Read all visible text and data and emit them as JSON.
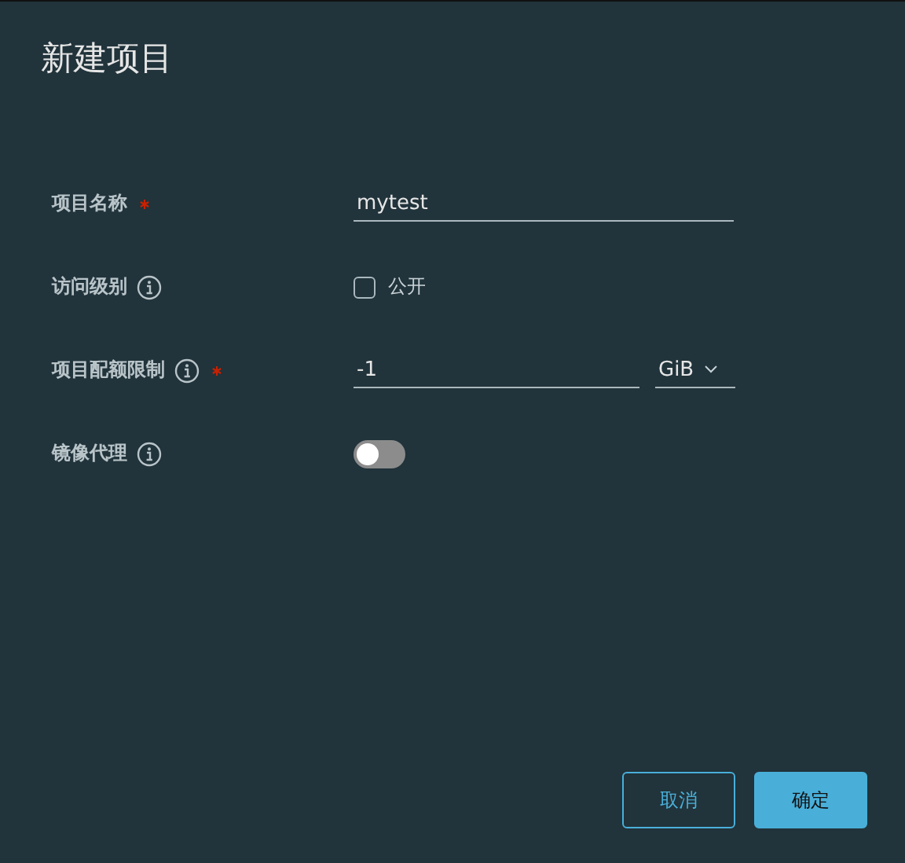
{
  "dialog": {
    "title": "新建项目"
  },
  "fields": [
    {
      "kind": "text",
      "label": "项目名称",
      "required": true,
      "info": false,
      "value": "mytest"
    },
    {
      "kind": "checkbox",
      "label": "访问级别",
      "required": false,
      "info": true,
      "option": "公开",
      "checked": false
    },
    {
      "kind": "quota",
      "label": "项目配额限制",
      "required": true,
      "info": true,
      "value": "-1",
      "unit": "GiB"
    },
    {
      "kind": "toggle",
      "label": "镜像代理",
      "required": false,
      "info": true,
      "on": false
    }
  ],
  "buttons": [
    {
      "label": "取消",
      "primary": false
    },
    {
      "label": "确定",
      "primary": true
    }
  ]
}
